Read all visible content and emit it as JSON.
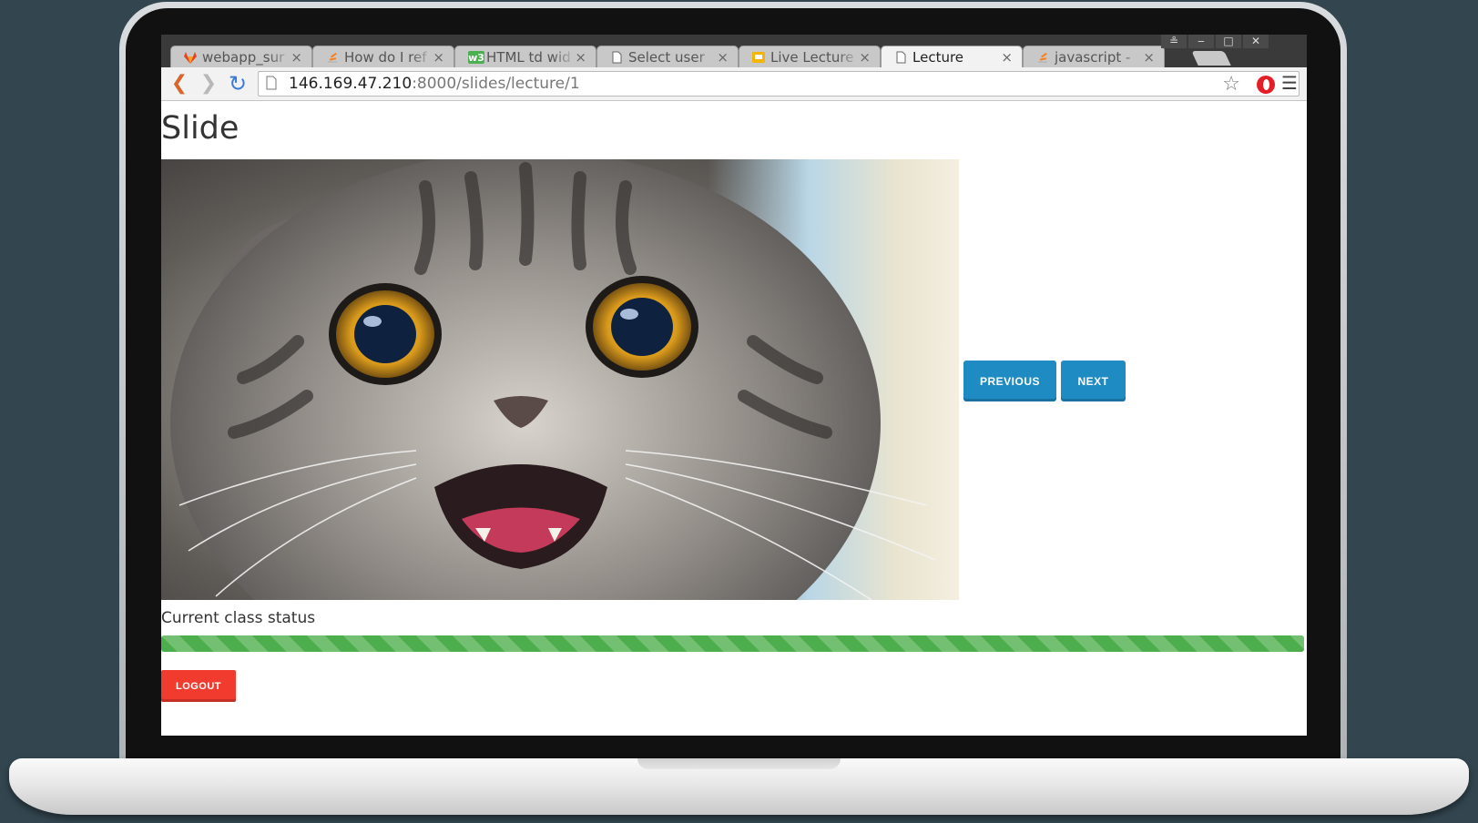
{
  "browser": {
    "tabs": [
      {
        "title": "webapp_sur",
        "icon": "gitlab-icon",
        "active": false
      },
      {
        "title": "How do I ref",
        "icon": "stackoverflow-icon",
        "active": false
      },
      {
        "title": "HTML td wid",
        "icon": "w3schools-icon",
        "active": false
      },
      {
        "title": "Select user",
        "icon": "page-icon",
        "active": false
      },
      {
        "title": "Live Lecture",
        "icon": "slides-icon",
        "active": false
      },
      {
        "title": "Lecture",
        "icon": "page-icon",
        "active": true
      },
      {
        "title": "javascript - ",
        "icon": "stackoverflow-icon",
        "active": false
      }
    ],
    "tab_close_glyph": "×",
    "url_host": "146.169.47.210",
    "url_rest": ":8000/slides/lecture/1",
    "window_controls": {
      "user": "≗",
      "minimize": "‒",
      "maximize": "□",
      "close": "✕"
    }
  },
  "page": {
    "title": "Slide",
    "slide_image_alt": "cat",
    "previous_label": "PREVIOUS",
    "next_label": "NEXT",
    "status_label": "Current class status",
    "progress_percent": 100,
    "logout_label": "LOGOUT"
  },
  "colors": {
    "primary_button": "#1f8bc3",
    "logout_button": "#f03b2e",
    "progress": "#4cae4c",
    "background": "#334650"
  }
}
